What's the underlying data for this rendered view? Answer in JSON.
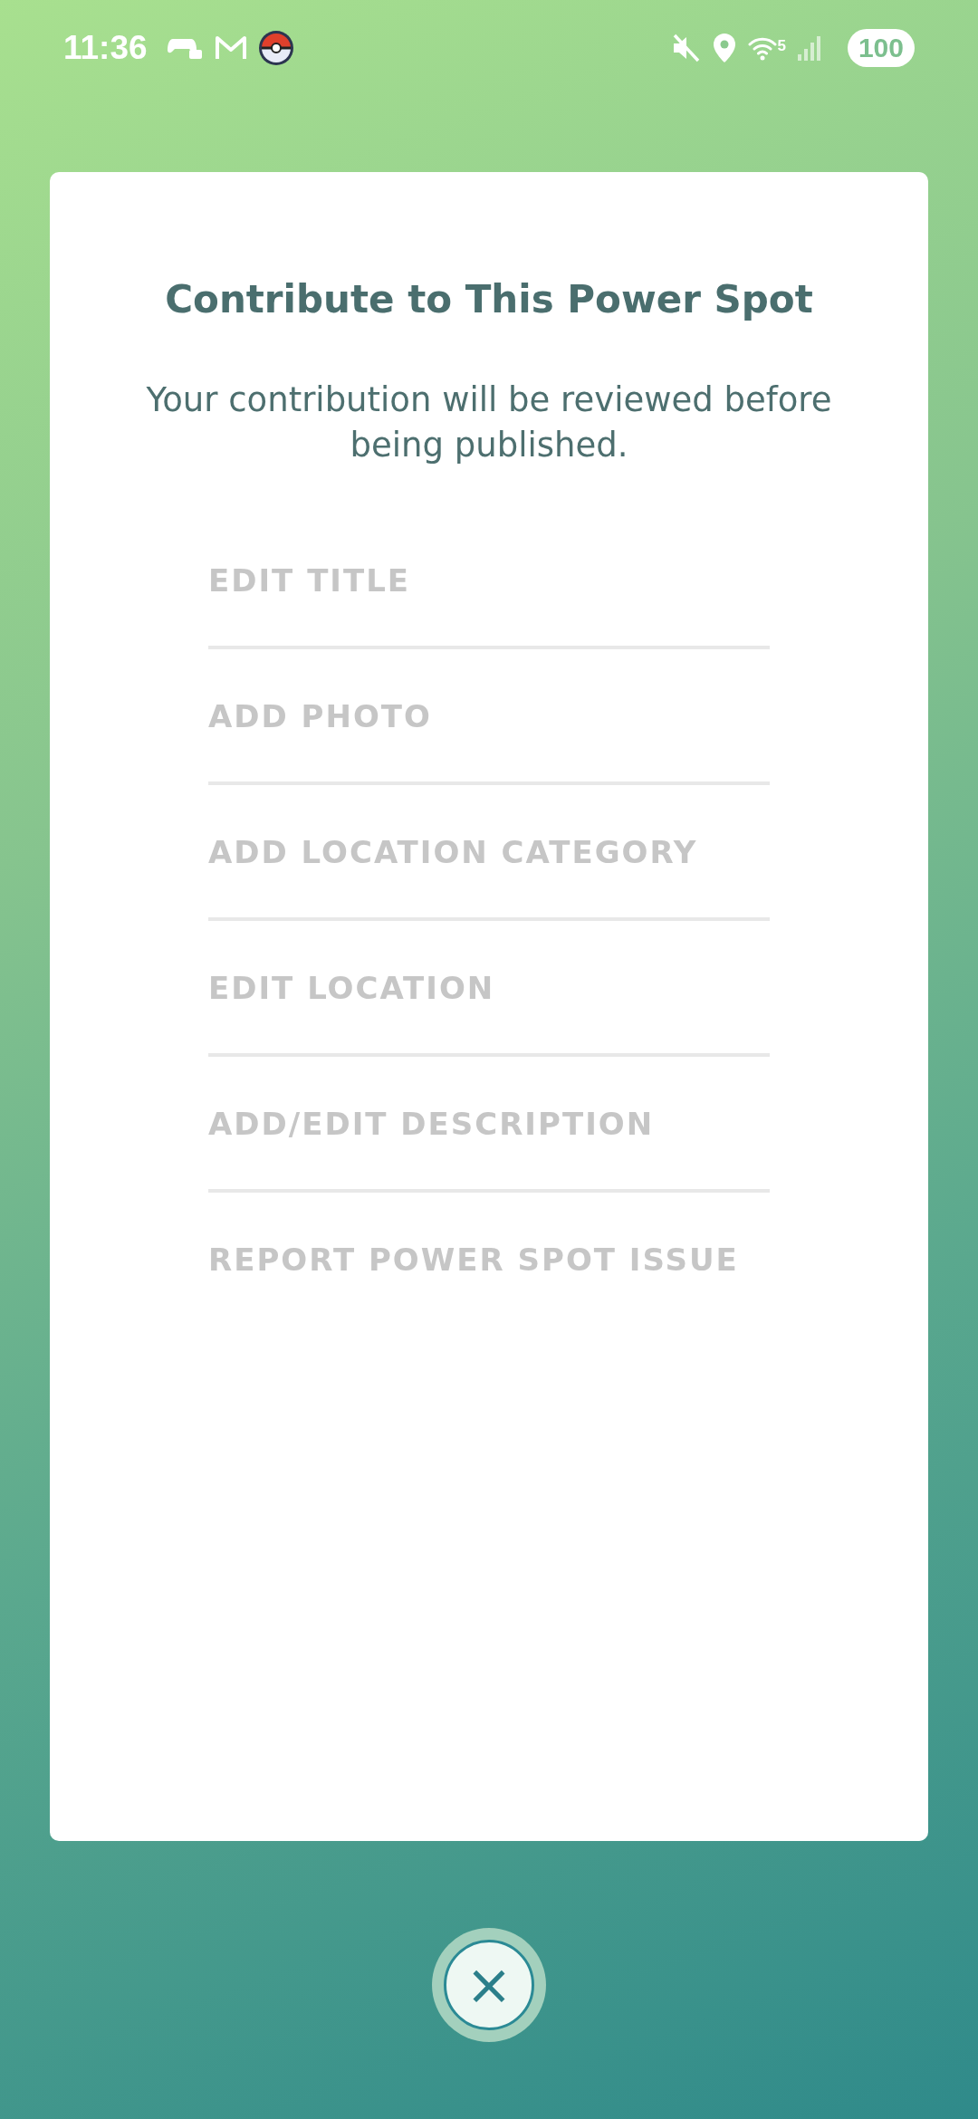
{
  "status_bar": {
    "time": "11:36",
    "wifi_band": "5",
    "battery": "100"
  },
  "dialog": {
    "title": "Contribute to This Power Spot",
    "subtitle": "Your contribution will be reviewed before being published.",
    "options": [
      {
        "label": "EDIT TITLE"
      },
      {
        "label": "ADD PHOTO"
      },
      {
        "label": "ADD LOCATION CATEGORY"
      },
      {
        "label": "EDIT LOCATION"
      },
      {
        "label": "ADD/EDIT DESCRIPTION"
      },
      {
        "label": "REPORT POWER SPOT ISSUE"
      }
    ]
  },
  "close_button": {
    "label": "×"
  }
}
